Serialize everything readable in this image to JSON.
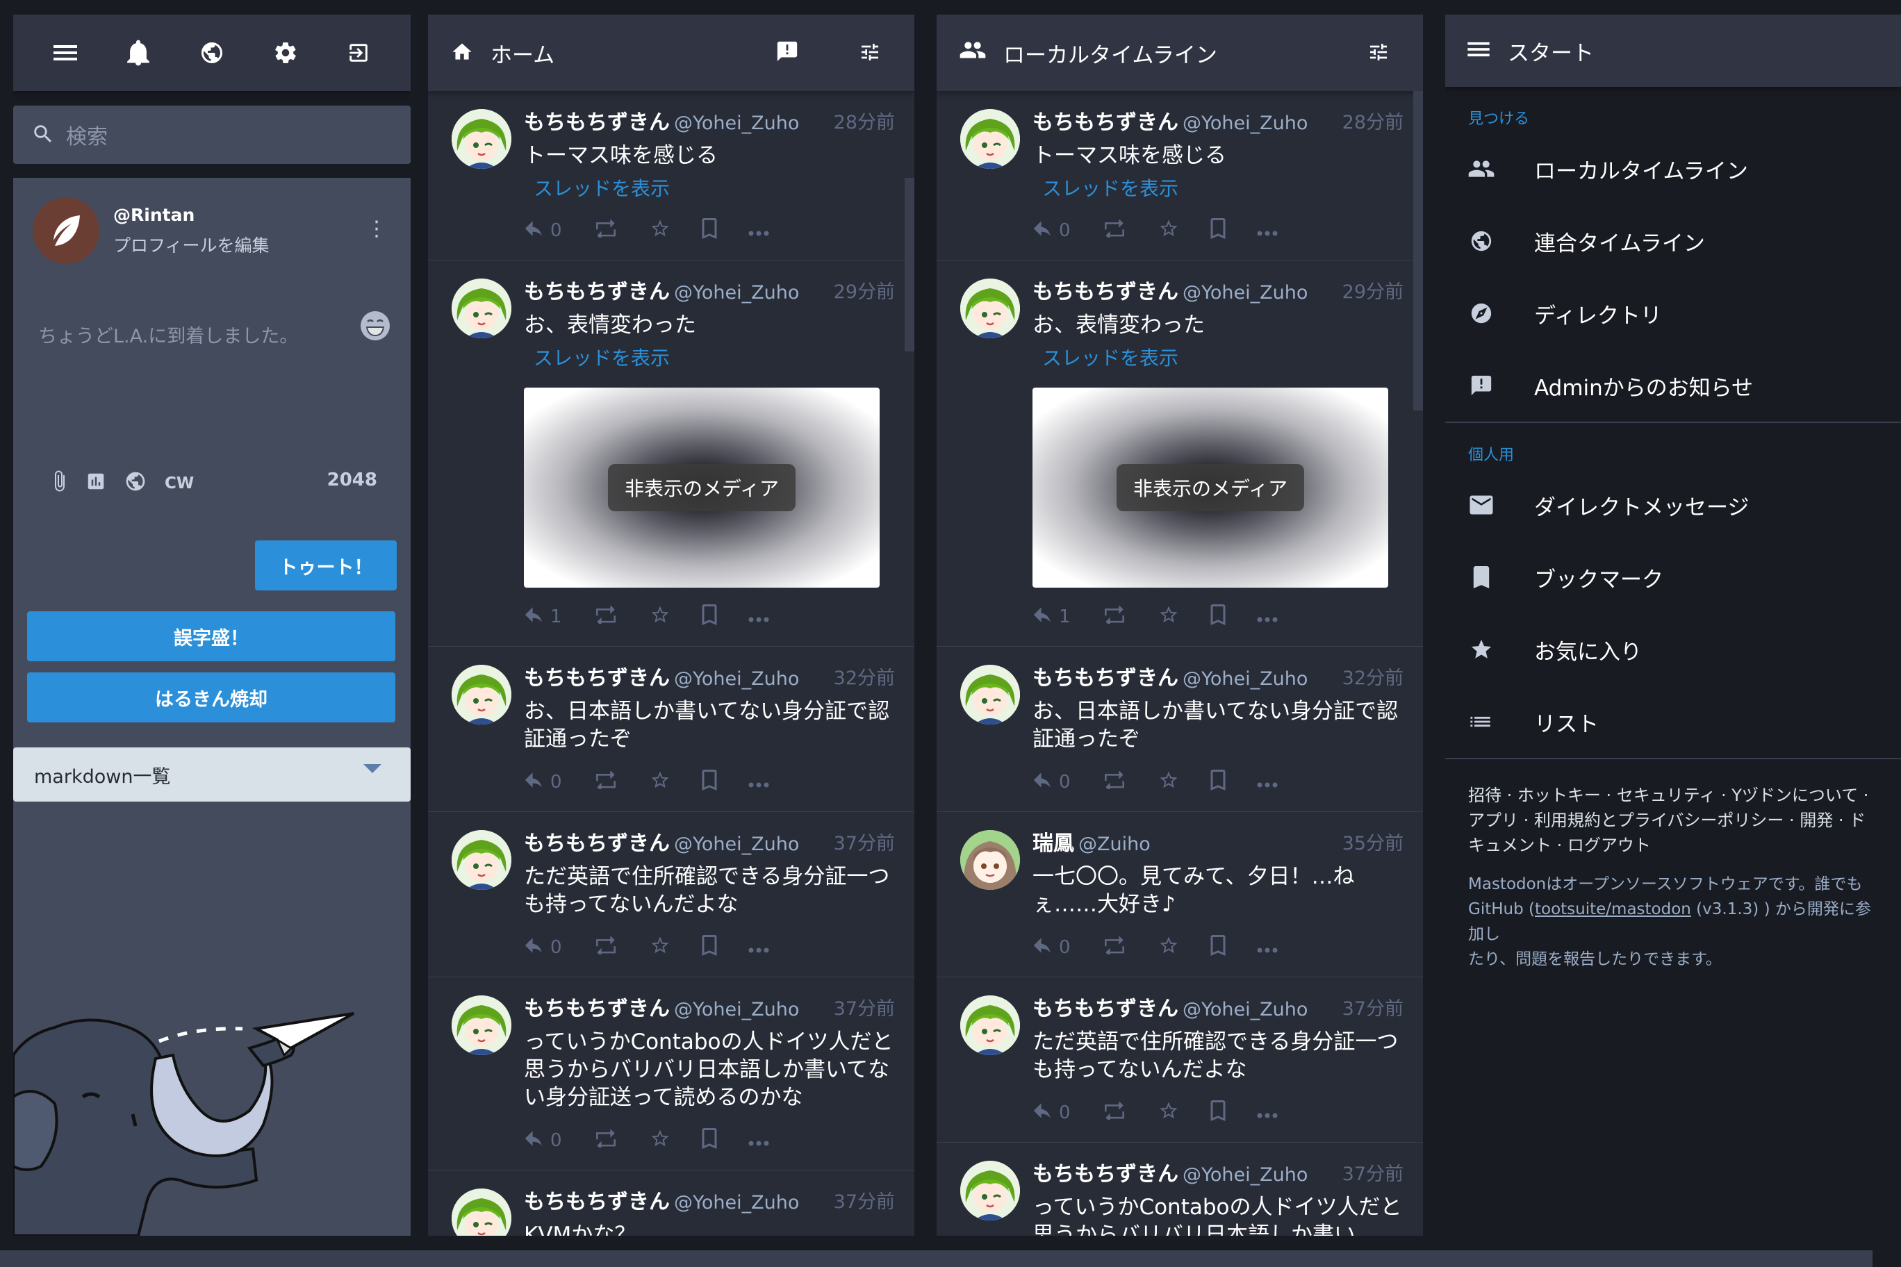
{
  "compose_column": {
    "search_placeholder": "検索",
    "account_handle": "@Rintan",
    "edit_profile": "プロフィールを編集",
    "compose_placeholder": "ちょうどL.A.に到着しました。",
    "cw_label": "CW",
    "char_count": "2048",
    "toot_button": "トゥート！",
    "button_1": "誤字盛！",
    "button_2": "はるきん焼却",
    "markdown_select": "markdown一覧",
    "nav_icons": [
      "menu-icon",
      "bell-icon",
      "globe-icon",
      "gear-icon",
      "logout-icon"
    ]
  },
  "home_column": {
    "title": "ホーム",
    "statuses": [
      {
        "name": "もちもちずきん",
        "handle": "@Yohei_Zuho",
        "time": "28分前",
        "text": "トーマス味を感じる",
        "thread": "スレッドを表示",
        "media": null,
        "replies": "0"
      },
      {
        "name": "もちもちずきん",
        "handle": "@Yohei_Zuho",
        "time": "29分前",
        "text": "お、表情変わった",
        "thread": "スレッドを表示",
        "media": "非表示のメディア",
        "replies": "1"
      },
      {
        "name": "もちもちずきん",
        "handle": "@Yohei_Zuho",
        "time": "32分前",
        "text": "お、日本語しか書いてない身分証で認証通ったぞ",
        "thread": null,
        "media": null,
        "replies": "0"
      },
      {
        "name": "もちもちずきん",
        "handle": "@Yohei_Zuho",
        "time": "37分前",
        "text": "ただ英語で住所確認できる身分証一つも持ってないんだよな",
        "thread": null,
        "media": null,
        "replies": "0"
      },
      {
        "name": "もちもちずきん",
        "handle": "@Yohei_Zuho",
        "time": "37分前",
        "text": "っていうかContaboの人ドイツ人だと思うからバリバリ日本語しか書いてない身分証送って読めるのかな",
        "thread": null,
        "media": null,
        "replies": "0"
      },
      {
        "name": "もちもちずきん",
        "handle": "@Yohei_Zuho",
        "time": "37分前",
        "text": "KVMかな？",
        "thread": null,
        "media": null,
        "replies": ""
      }
    ]
  },
  "local_column": {
    "title": "ローカルタイムライン",
    "statuses": [
      {
        "name": "もちもちずきん",
        "handle": "@Yohei_Zuho",
        "time": "28分前",
        "text": "トーマス味を感じる",
        "thread": "スレッドを表示",
        "media": null,
        "replies": "0",
        "avatar": "green"
      },
      {
        "name": "もちもちずきん",
        "handle": "@Yohei_Zuho",
        "time": "29分前",
        "text": "お、表情変わった",
        "thread": "スレッドを表示",
        "media": "非表示のメディア",
        "replies": "1",
        "avatar": "green"
      },
      {
        "name": "もちもちずきん",
        "handle": "@Yohei_Zuho",
        "time": "32分前",
        "text": "お、日本語しか書いてない身分証で認証通ったぞ",
        "thread": null,
        "media": null,
        "replies": "0",
        "avatar": "green"
      },
      {
        "name": "瑞鳳",
        "handle": "@Zuiho",
        "time": "35分前",
        "text": "一七〇〇。見てみて、夕日！…ねぇ……大好き♪",
        "thread": null,
        "media": null,
        "replies": "0",
        "avatar": "brown"
      },
      {
        "name": "もちもちずきん",
        "handle": "@Yohei_Zuho",
        "time": "37分前",
        "text": "ただ英語で住所確認できる身分証一つも持ってないんだよな",
        "thread": null,
        "media": null,
        "replies": "0",
        "avatar": "green"
      },
      {
        "name": "もちもちずきん",
        "handle": "@Yohei_Zuho",
        "time": "37分前",
        "text": "っていうかContaboの人ドイツ人だと思うからバリバリ日本語しか書い",
        "thread": null,
        "media": null,
        "replies": "",
        "avatar": "green"
      }
    ]
  },
  "start_column": {
    "title": "スタート",
    "discover_label": "見つける",
    "discover_items": [
      {
        "label": "ローカルタイムライン",
        "icon": "people-icon"
      },
      {
        "label": "連合タイムライン",
        "icon": "globe-icon"
      },
      {
        "label": "ディレクトリ",
        "icon": "compass-icon"
      },
      {
        "label": "Adminからのお知らせ",
        "icon": "announcement-icon"
      }
    ],
    "personal_label": "個人用",
    "personal_items": [
      {
        "label": "ダイレクトメッセージ",
        "icon": "envelope-icon"
      },
      {
        "label": "ブックマーク",
        "icon": "bookmark-icon"
      },
      {
        "label": "お気に入り",
        "icon": "star-icon"
      },
      {
        "label": "リスト",
        "icon": "list-icon"
      }
    ],
    "footer_links_1": "招待 · ホットキー · セキュリティ · Yヅドンについて ·",
    "footer_links_2": "アプリ · 利用規約とプライバシーポリシー · 開発 · ド",
    "footer_links_3": "キュメント · ログアウト",
    "about_1": "Mastodonはオープンソースソフトウェアです。誰でも",
    "about_2a": "GitHub (",
    "about_link": "tootsuite/mastodon",
    "about_2b": " (v3.1.3) ) から開発に参加し",
    "about_3": "たり、問題を報告したりできます。"
  },
  "colors": {
    "accent": "#2b90d9",
    "background": "#191b22",
    "column": "#282c37",
    "header": "#313543"
  }
}
